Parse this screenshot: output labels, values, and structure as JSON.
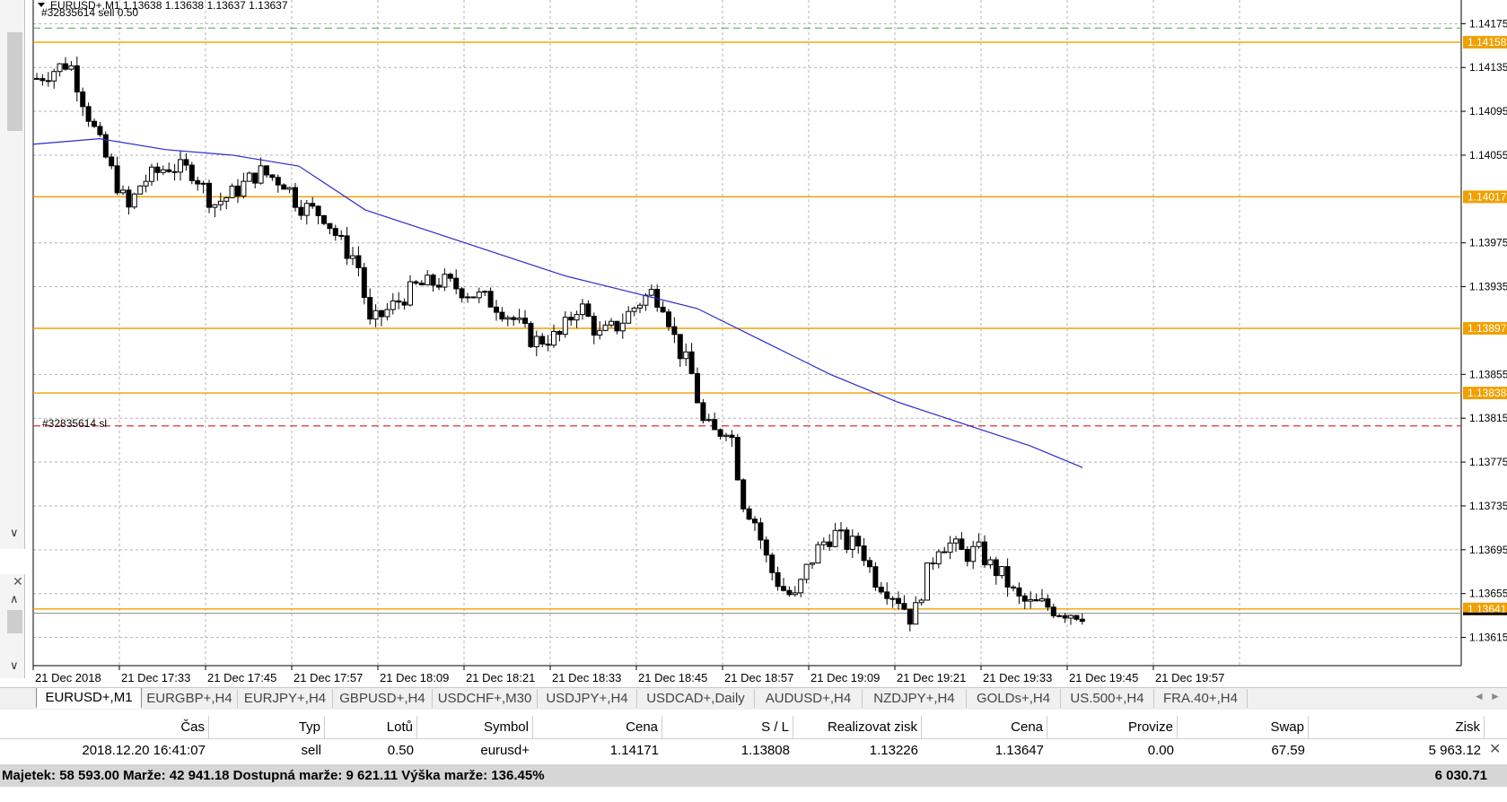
{
  "chart": {
    "header_text": "EURUSD+,M1  1.13638 1.13638 1.13637 1.13637",
    "order_label": "#32835614 sell 0.50",
    "sl_label": "#32835614 sl",
    "price_labels": [
      "1.14175",
      "1.14135",
      "1.14095",
      "1.14055",
      "1.13975",
      "1.13935",
      "1.13855",
      "1.13815",
      "1.13775",
      "1.13735",
      "1.13695",
      "1.13655",
      "1.13615"
    ],
    "marker_labels": [
      "1.14158",
      "1.14017",
      "1.13897",
      "1.13838",
      "1.13641"
    ],
    "time_labels": [
      "21 Dec 2018",
      "21 Dec 17:33",
      "21 Dec 17:45",
      "21 Dec 17:57",
      "21 Dec 18:09",
      "21 Dec 18:21",
      "21 Dec 18:33",
      "21 Dec 18:45",
      "21 Dec 18:57",
      "21 Dec 19:09",
      "21 Dec 19:21",
      "21 Dec 19:33",
      "21 Dec 19:45",
      "21 Dec 19:57"
    ],
    "colors": {
      "grid": "#b4b4b4",
      "candle": "#000000",
      "ma": "#2a2ad0",
      "level": "#f0a000",
      "sl": "#e03030",
      "tp": "#40b040",
      "marker_bg": "#f0a000"
    }
  },
  "chart_data": {
    "type": "candlestick",
    "symbol": "EURUSD+",
    "timeframe": "M1",
    "ylim": [
      1.13595,
      1.1419
    ],
    "x_range": [
      "21 Dec 17:23",
      "21 Dec 19:57"
    ],
    "levels": [
      1.14158,
      1.14017,
      1.13897,
      1.13838,
      1.13641
    ],
    "stop_loss": 1.13808,
    "take_profit": 1.14171,
    "current_price": 1.13637,
    "close_path": [
      [
        0,
        1.14125
      ],
      [
        5,
        1.1414
      ],
      [
        8,
        1.1409
      ],
      [
        10,
        1.1406
      ],
      [
        14,
        1.14005
      ],
      [
        16,
        1.1403
      ],
      [
        20,
        1.14045
      ],
      [
        24,
        1.1404
      ],
      [
        27,
        1.1401
      ],
      [
        30,
        1.1402
      ],
      [
        34,
        1.1404
      ],
      [
        38,
        1.1403
      ],
      [
        40,
        1.1401
      ],
      [
        44,
        1.14
      ],
      [
        47,
        1.1397
      ],
      [
        49,
        1.1396
      ],
      [
        51,
        1.139
      ],
      [
        54,
        1.13915
      ],
      [
        58,
        1.13935
      ],
      [
        62,
        1.1394
      ],
      [
        66,
        1.1393
      ],
      [
        70,
        1.1392
      ],
      [
        73,
        1.13905
      ],
      [
        76,
        1.13885
      ],
      [
        80,
        1.1389
      ],
      [
        83,
        1.1392
      ],
      [
        86,
        1.1389
      ],
      [
        89,
        1.139
      ],
      [
        92,
        1.1392
      ],
      [
        94,
        1.1393
      ],
      [
        96,
        1.1392
      ],
      [
        98,
        1.1388
      ],
      [
        100,
        1.1386
      ],
      [
        102,
        1.1381
      ],
      [
        104,
        1.138
      ],
      [
        106,
        1.1381
      ],
      [
        108,
        1.1374
      ],
      [
        110,
        1.1372
      ],
      [
        112,
        1.1368
      ],
      [
        114,
        1.1366
      ],
      [
        116,
        1.1365
      ],
      [
        118,
        1.1368
      ],
      [
        120,
        1.137
      ],
      [
        122,
        1.1371
      ],
      [
        124,
        1.137
      ],
      [
        126,
        1.137
      ],
      [
        128,
        1.1367
      ],
      [
        130,
        1.1366
      ],
      [
        132,
        1.1365
      ],
      [
        134,
        1.1363
      ],
      [
        136,
        1.1367
      ],
      [
        138,
        1.137
      ],
      [
        140,
        1.137
      ],
      [
        142,
        1.1369
      ],
      [
        144,
        1.13695
      ],
      [
        146,
        1.1368
      ],
      [
        148,
        1.1367
      ],
      [
        150,
        1.1365
      ],
      [
        152,
        1.13645
      ],
      [
        154,
        1.13645
      ],
      [
        156,
        1.1364
      ],
      [
        158,
        1.13638
      ],
      [
        160,
        1.13637
      ]
    ],
    "ma_path": [
      [
        0,
        1.14065
      ],
      [
        10,
        1.1407
      ],
      [
        20,
        1.1406
      ],
      [
        30,
        1.14055
      ],
      [
        40,
        1.14045
      ],
      [
        50,
        1.14005
      ],
      [
        60,
        1.13985
      ],
      [
        70,
        1.13965
      ],
      [
        80,
        1.13945
      ],
      [
        90,
        1.1393
      ],
      [
        100,
        1.13915
      ],
      [
        110,
        1.13885
      ],
      [
        120,
        1.13855
      ],
      [
        130,
        1.1383
      ],
      [
        140,
        1.1381
      ],
      [
        150,
        1.1379
      ],
      [
        158,
        1.1377
      ]
    ]
  },
  "tabs": [
    {
      "label": "EURUSD+,M1",
      "active": true
    },
    {
      "label": "EURGBP+,H4"
    },
    {
      "label": "EURJPY+,H4"
    },
    {
      "label": "GBPUSD+,H4"
    },
    {
      "label": "USDCHF+,M30"
    },
    {
      "label": "USDJPY+,H4"
    },
    {
      "label": "USDCAD+,Daily"
    },
    {
      "label": "AUDUSD+,H4"
    },
    {
      "label": "NZDJPY+,H4"
    },
    {
      "label": "GOLDs+,H4"
    },
    {
      "label": "US.500+,H4"
    },
    {
      "label": "FRA.40+,H4"
    }
  ],
  "tab_scroll": {
    "left": "◄",
    "right": "►"
  },
  "terminal": {
    "headers": [
      "Čas",
      "Typ",
      "Lotů",
      "Symbol",
      "Cena",
      "S / L",
      "Realizovat zisk",
      "Cena",
      "Provize",
      "Swap",
      "Zisk"
    ],
    "row": [
      "2018.12.20 16:41:07",
      "sell",
      "0.50",
      "eurusd+",
      "1.14171",
      "1.13808",
      "1.13226",
      "1.13647",
      "0.00",
      "67.59",
      "5 963.12"
    ],
    "summary": "Majetek: 58 593.00  Marže: 42 941.18  Dostupná marže: 9 621.11  Výška marže: 136.45%",
    "summary_total": "6 030.71",
    "close_glyph": "✕"
  },
  "side_panel": {
    "close_glyph": "✕",
    "scroll_down": "∨",
    "scroll_up": "∧",
    "scroll_down2": "∨"
  }
}
